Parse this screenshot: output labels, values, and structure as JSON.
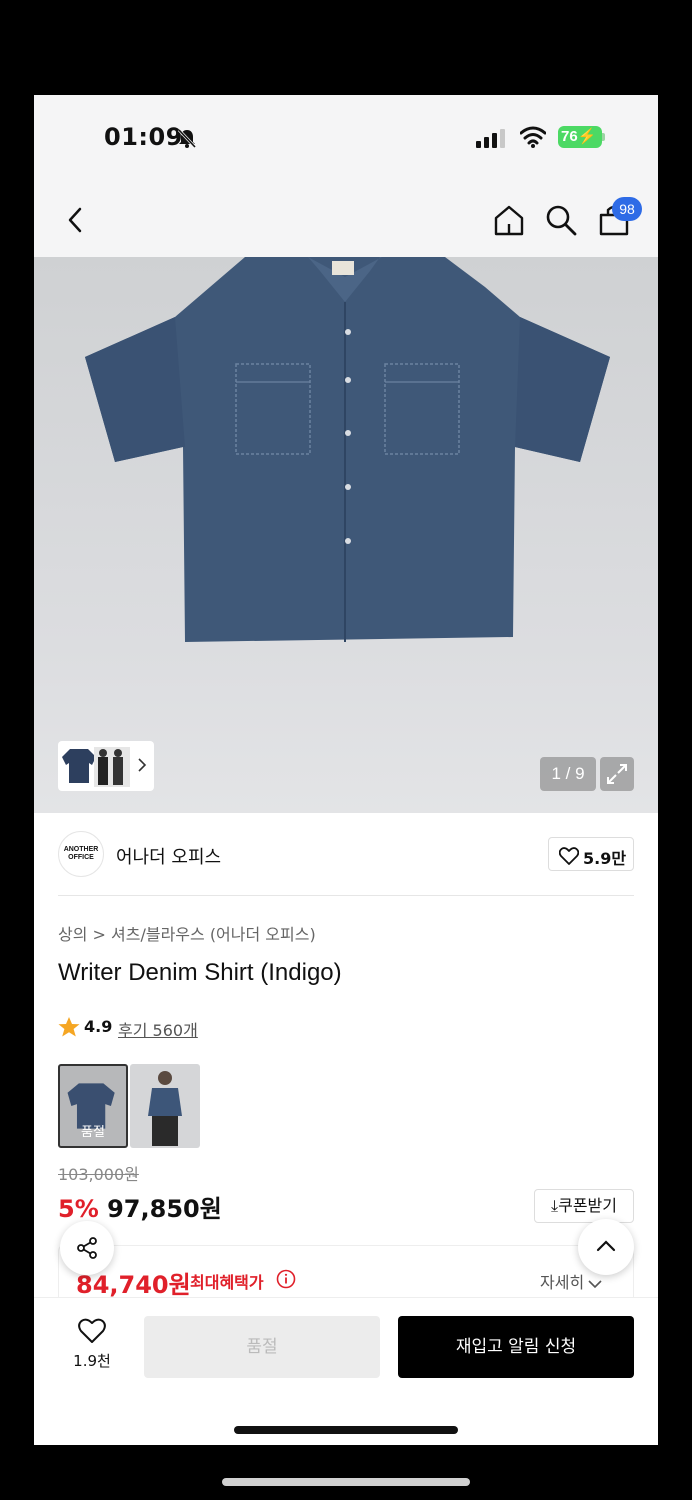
{
  "status_bar": {
    "time": "01:09",
    "battery": "76"
  },
  "nav": {
    "cart_count": "98"
  },
  "gallery": {
    "counter": "1 / 9"
  },
  "brand": {
    "logo_text": "ANOTHER OFFICE",
    "name": "어나더 오피스",
    "likes": "5.9만"
  },
  "breadcrumb": "상의 > 셔츠/블라우스 (어나더 오피스)",
  "product": {
    "title": "Writer Denim Shirt (Indigo)",
    "rating": "4.9",
    "reviews": "후기 560개",
    "option_soldout_label": "품절"
  },
  "price": {
    "original": "103,000원",
    "discount_pct": "5%",
    "sale": "97,850원",
    "coupon_label": "쿠폰받기",
    "max_benefit_price": "84,740원",
    "max_benefit_label": "최대혜택가",
    "detail_label": "자세히"
  },
  "bottom": {
    "wish_count": "1.9천",
    "soldout_label": "품절",
    "restock_label": "재입고 알림 신청"
  },
  "colors": {
    "accent_red": "#e0202a",
    "badge_blue": "#2e6be6",
    "battery_green": "#4cd964",
    "shirt_indigo": "#3f5878"
  }
}
